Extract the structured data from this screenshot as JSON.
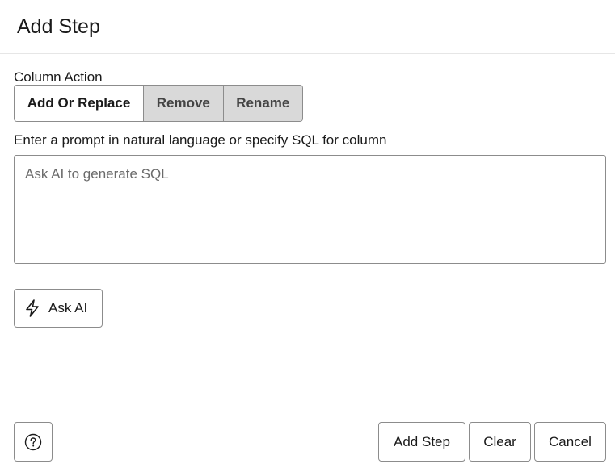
{
  "dialog": {
    "title": "Add Step"
  },
  "column_action": {
    "label": "Column Action",
    "options": [
      {
        "label": "Add Or Replace",
        "selected": true
      },
      {
        "label": "Remove",
        "selected": false
      },
      {
        "label": "Rename",
        "selected": false
      }
    ]
  },
  "prompt": {
    "label": "Enter a prompt in natural language or specify SQL for column",
    "value": "",
    "placeholder": "Ask AI to generate SQL"
  },
  "ask_ai": {
    "label": "Ask AI",
    "icon": "lightning-bolt-icon"
  },
  "footer": {
    "help_icon": "question-circle-icon",
    "add_step_label": "Add Step",
    "clear_label": "Clear",
    "cancel_label": "Cancel"
  },
  "colors": {
    "border": "#8c8c8c",
    "inactive_segment_bg": "#d9d9d9",
    "divider": "#e6e6e6"
  }
}
